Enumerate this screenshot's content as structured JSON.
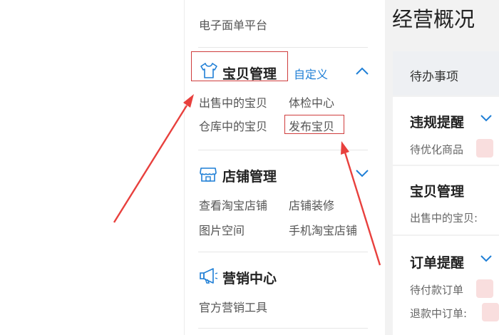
{
  "sidebar": {
    "top_link": "电子面单平台",
    "sections": [
      {
        "title": "宝贝管理",
        "custom_label": "自定义",
        "links": [
          "出售中的宝贝",
          "体检中心",
          "仓库中的宝贝",
          "发布宝贝"
        ]
      },
      {
        "title": "店铺管理",
        "links": [
          "查看淘宝店铺",
          "店铺装修",
          "图片空间",
          "手机淘宝店铺"
        ]
      },
      {
        "title": "营销中心",
        "links": [
          "官方营销工具"
        ]
      }
    ]
  },
  "main": {
    "title": "经营概况",
    "todo_label": "待办事项",
    "cards": [
      {
        "title": "违规提醒",
        "rows": [
          "待优化商品"
        ]
      },
      {
        "title": "宝贝管理",
        "rows": [
          "出售中的宝贝:"
        ]
      },
      {
        "title": "订单提醒",
        "rows": [
          "待付款订单",
          "退款中订单:"
        ]
      }
    ]
  },
  "colors": {
    "accent_blue": "#1f7fd6",
    "highlight_red": "#cf3d3d",
    "annotation_arrow": "#e8403d"
  },
  "icons": [
    "tshirt-icon",
    "store-icon",
    "megaphone-icon",
    "chevron-up-icon",
    "chevron-down-icon"
  ]
}
